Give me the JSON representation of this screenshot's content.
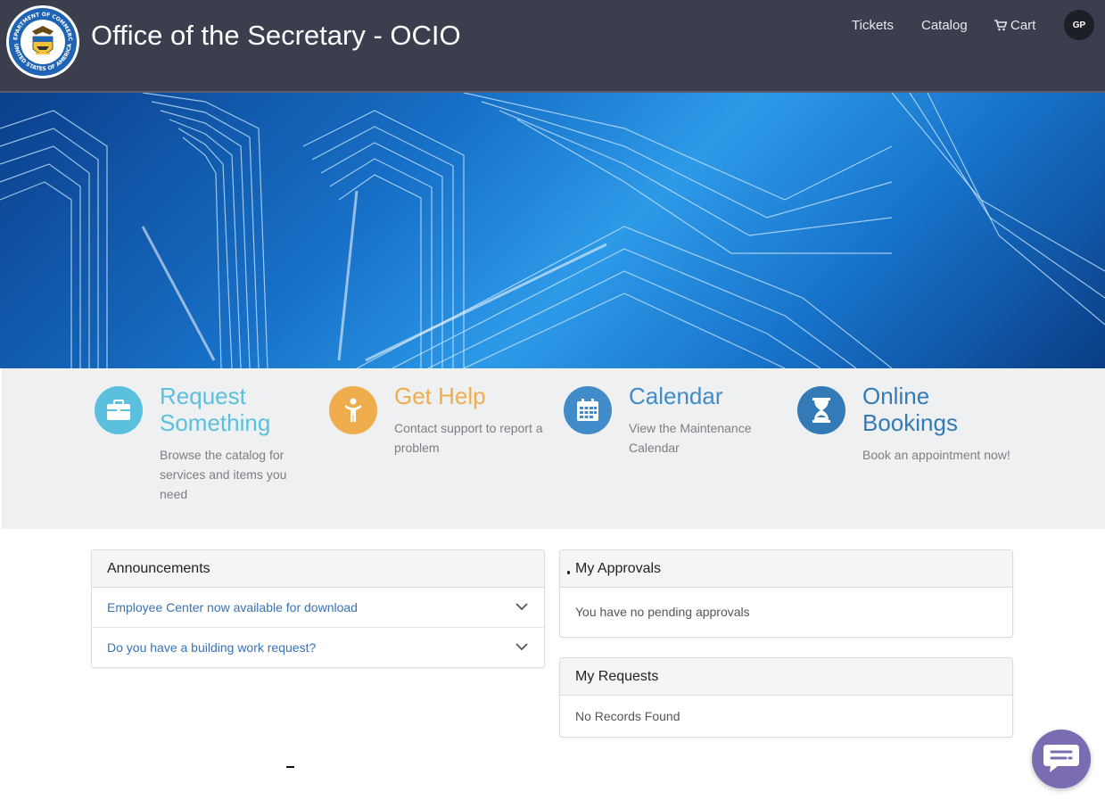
{
  "header": {
    "site_title": "Office of the Secretary - OCIO",
    "seal_text_top": "DEPARTMENT OF COMMERCE",
    "seal_text_bottom": "UNITED STATES OF AMERICA",
    "nav": {
      "tickets": "Tickets",
      "catalog": "Catalog",
      "cart": "Cart"
    },
    "avatar_initials": "GP"
  },
  "tiles": [
    {
      "title": "Request Something",
      "description": "Browse the catalog for services and items you need",
      "icon": "briefcase-icon",
      "color": "#5bc0de",
      "title_color": "#5bc0de"
    },
    {
      "title": "Get Help",
      "description": "Contact support to report a problem",
      "icon": "person-icon",
      "color": "#f0ad4e",
      "title_color": "#f0ad4e"
    },
    {
      "title": "Calendar",
      "description": "View the Maintenance Calendar",
      "icon": "calendar-icon",
      "color": "#428bca",
      "title_color": "#428bca"
    },
    {
      "title": "Online Bookings",
      "description": "Book an appointment now!",
      "icon": "hourglass-icon",
      "color": "#337ab7",
      "title_color": "#337ab7"
    }
  ],
  "announcements": {
    "title": "Announcements",
    "items": [
      "Employee Center now available for download",
      "Do you have a building work request?"
    ]
  },
  "approvals": {
    "title": "My Approvals",
    "empty_text": "You have no pending approvals"
  },
  "requests": {
    "title": "My Requests",
    "empty_text": "No Records Found"
  },
  "chat": {
    "icon": "chat-bubble-icon"
  },
  "colors": {
    "header_bg": "#3a3e4d",
    "band_bg": "#eef0f1",
    "link": "#3a72b5",
    "chat": "#7b6bb1"
  }
}
